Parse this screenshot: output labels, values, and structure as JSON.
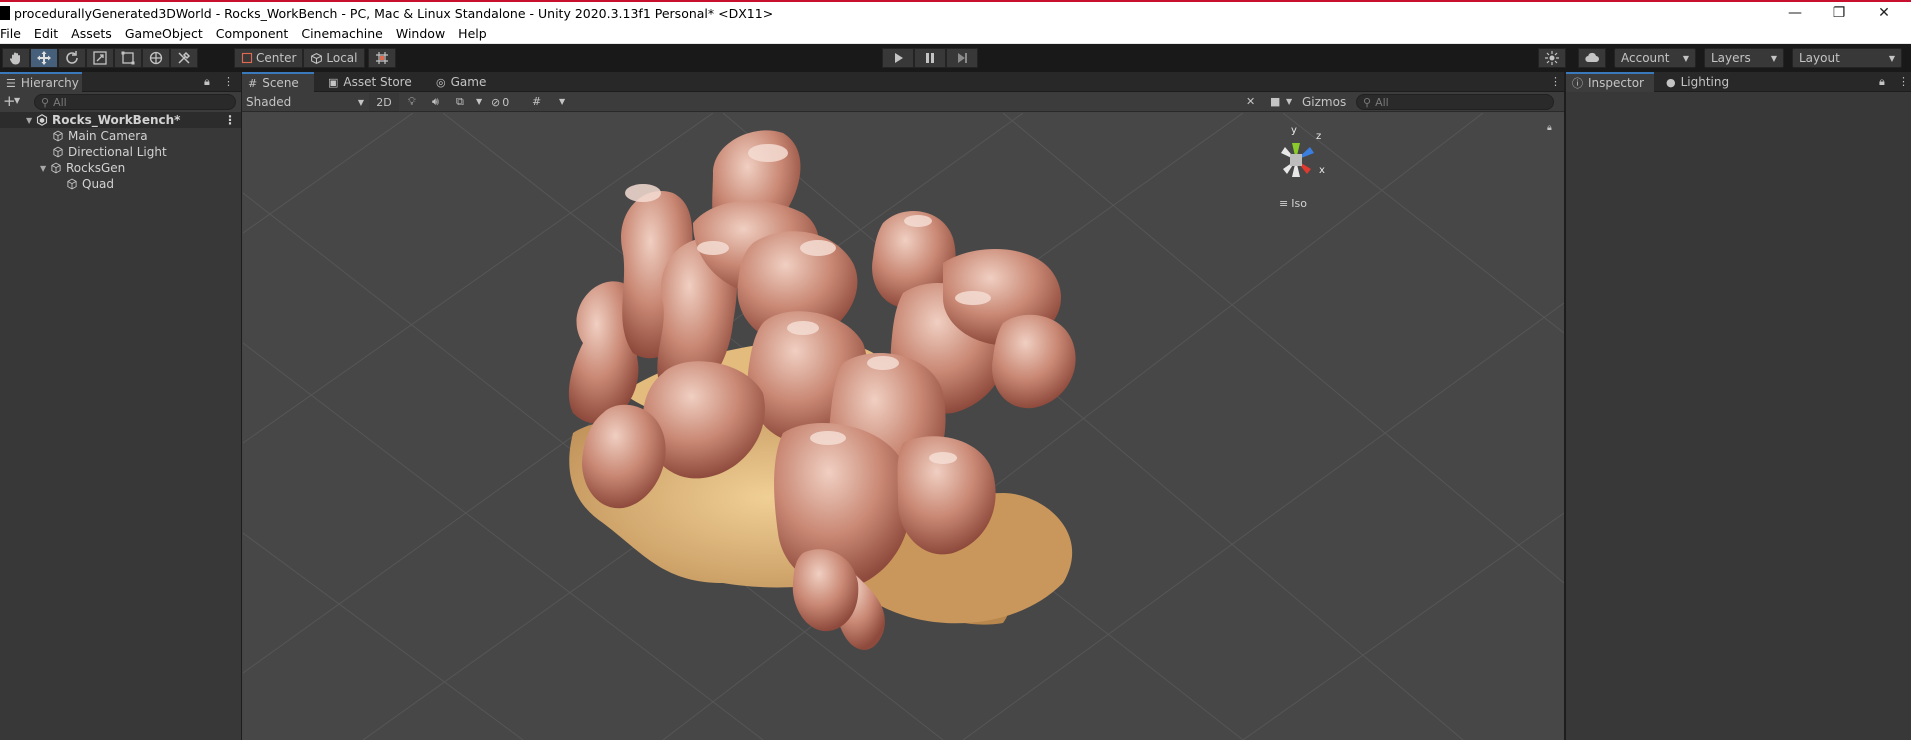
{
  "window": {
    "title": "procedurallyGenerated3DWorld - Rocks_WorkBench - PC, Mac & Linux Standalone - Unity 2020.3.13f1 Personal* <DX11>",
    "minimize_glyph": "—",
    "maximize_glyph": "❐",
    "close_glyph": "✕"
  },
  "menu": {
    "items": [
      "File",
      "Edit",
      "Assets",
      "GameObject",
      "Component",
      "Cinemachine",
      "Window",
      "Help"
    ]
  },
  "toolbar": {
    "pivot_label": "Center",
    "space_label": "Local",
    "account_label": "Account",
    "layers_label": "Layers",
    "layout_label": "Layout"
  },
  "hierarchy": {
    "tab_label": "Hierarchy",
    "add_label": "+",
    "search_placeholder": "All",
    "scene_name": "Rocks_WorkBench*",
    "objects": [
      "Main Camera",
      "Directional Light",
      "RocksGen",
      "Quad"
    ]
  },
  "scene_tabs": {
    "scene": "Scene",
    "asset_store": "Asset Store",
    "game": "Game"
  },
  "scene_bar": {
    "shading_mode": "Shaded",
    "mode_2d": "2D",
    "hidden_count": "0",
    "gizmos_label": "Gizmos",
    "search_placeholder": "All"
  },
  "gizmo": {
    "axis_y": "y",
    "axis_z": "z",
    "axis_x": "x",
    "projection_label": "Iso",
    "colors": {
      "x": "#e03a2f",
      "y": "#8bcb2c",
      "z": "#3a7ee0"
    }
  },
  "inspector": {
    "tab_inspector": "Inspector",
    "tab_lighting": "Lighting"
  },
  "colors": {
    "accent": "#3a79bb",
    "titlebar_border": "#c8102e",
    "rock_light": "#e6b8a8",
    "rock_dark": "#a05a4a",
    "sand": "#d9a86a"
  }
}
